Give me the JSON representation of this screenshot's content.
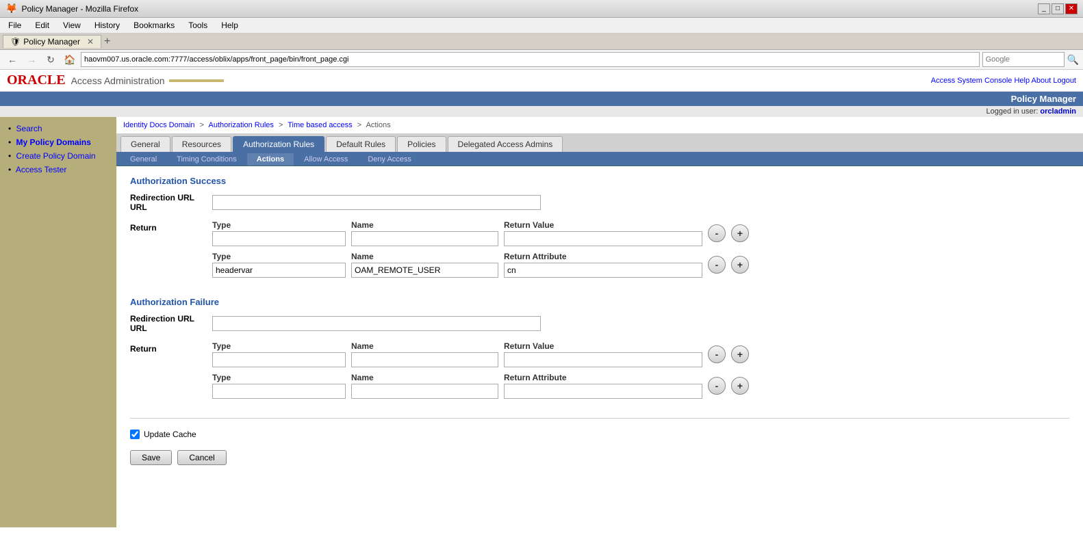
{
  "browser": {
    "title": "Policy Manager - Mozilla Firefox",
    "url": "haovm007.us.oracle.com:7777/access/oblix/apps/front_page/bin/front_page.cgi",
    "tab_label": "Policy Manager"
  },
  "menu": {
    "items": [
      "File",
      "Edit",
      "View",
      "History",
      "Bookmarks",
      "Tools",
      "Help"
    ]
  },
  "oracle": {
    "logo": "ORACLE",
    "subtitle": "Access Administration",
    "links": [
      "Access System Console",
      "Help",
      "About",
      "Logout"
    ]
  },
  "policy_bar": {
    "label": "Policy Manager",
    "logged_in_prefix": "Logged in user:",
    "user": "orcladmin"
  },
  "sidebar": {
    "items": [
      {
        "label": "Search",
        "active": false
      },
      {
        "label": "My Policy Domains",
        "active": true
      },
      {
        "label": "Create Policy Domain",
        "active": false
      },
      {
        "label": "Access Tester",
        "active": false
      }
    ]
  },
  "breadcrumb": {
    "items": [
      "Identity Docs Domain",
      "Authorization Rules",
      "Time based access",
      "Actions"
    ],
    "separators": [
      ">",
      ">",
      ">"
    ]
  },
  "tabs_primary": {
    "items": [
      "General",
      "Resources",
      "Authorization Rules",
      "Default Rules",
      "Policies",
      "Delegated Access Admins"
    ],
    "active": "Authorization Rules"
  },
  "tabs_secondary": {
    "items": [
      "General",
      "Timing Conditions",
      "Actions",
      "Allow Access",
      "Deny Access"
    ],
    "active": "Actions"
  },
  "auth_success": {
    "title": "Authorization Success",
    "redirection_url_label": "Redirection URL",
    "redirection_url_value": "",
    "return_label": "Return",
    "col_type": "Type",
    "col_name": "Name",
    "col_return_value": "Return Value",
    "col_return_attribute": "Return Attribute",
    "row1": {
      "type": "",
      "name": "",
      "return_value": ""
    },
    "row2": {
      "type": "headervar",
      "name": "OAM_REMOTE_USER",
      "return_attribute": "cn"
    }
  },
  "auth_failure": {
    "title": "Authorization Failure",
    "redirection_url_label": "Redirection URL",
    "redirection_url_value": "",
    "return_label": "Return",
    "col_type": "Type",
    "col_name": "Name",
    "col_return_value": "Return Value",
    "col_return_attribute": "Return Attribute",
    "row1": {
      "type": "",
      "name": "",
      "return_value": ""
    },
    "row2": {
      "type": "",
      "name": "",
      "return_attribute": ""
    }
  },
  "update_cache": {
    "label": "Update Cache",
    "checked": true
  },
  "buttons": {
    "save": "Save",
    "cancel": "Cancel"
  }
}
